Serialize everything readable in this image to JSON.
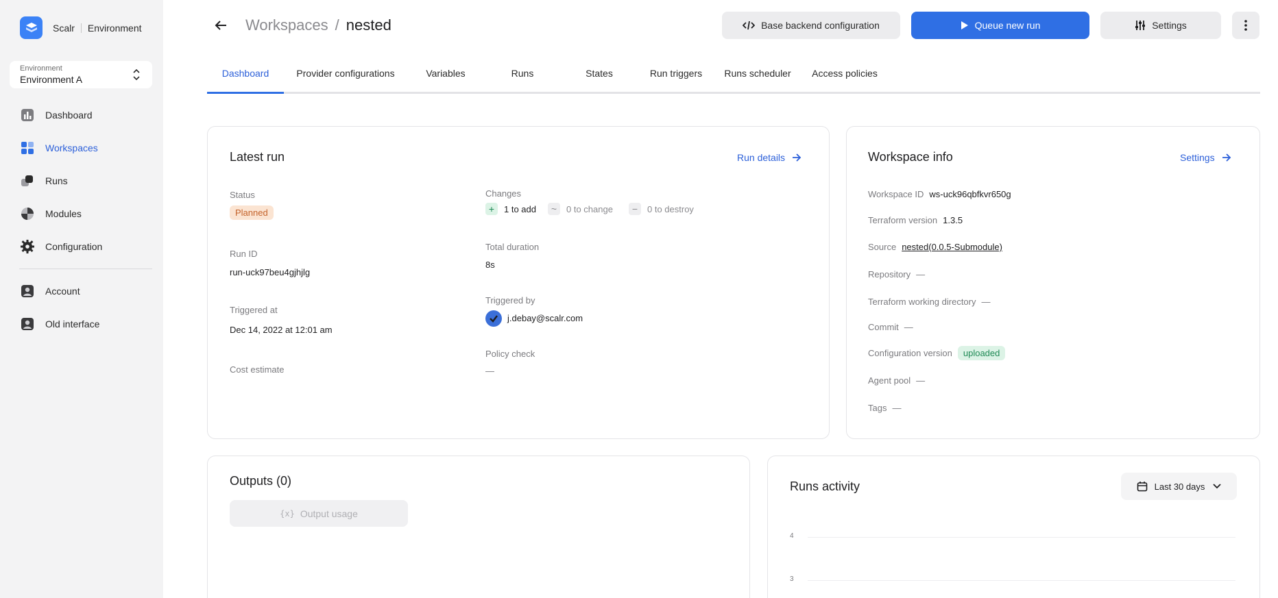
{
  "brand": {
    "name": "Scalr",
    "section": "Environment"
  },
  "environment": {
    "label": "Environment",
    "value": "Environment A"
  },
  "sidebar": {
    "items": [
      {
        "label": "Dashboard",
        "icon": "dashboard-icon"
      },
      {
        "label": "Workspaces",
        "icon": "workspaces-icon",
        "active": true
      },
      {
        "label": "Runs",
        "icon": "runs-icon"
      },
      {
        "label": "Modules",
        "icon": "modules-icon"
      },
      {
        "label": "Configuration",
        "icon": "gear-icon"
      },
      {
        "label": "Account",
        "icon": "account-icon"
      },
      {
        "label": "Old interface",
        "icon": "old-interface-icon"
      }
    ]
  },
  "header": {
    "parent": "Workspaces",
    "separator": "/",
    "current": "nested",
    "buttons": {
      "backend": "Base backend configuration",
      "queue": "Queue new run",
      "settings": "Settings"
    }
  },
  "tabs": [
    "Dashboard",
    "Provider configurations",
    "Variables",
    "Runs",
    "States",
    "Run triggers",
    "Runs scheduler",
    "Access policies"
  ],
  "latest_run": {
    "title": "Latest run",
    "details_link": "Run details",
    "status_label": "Status",
    "status": "Planned",
    "run_id_label": "Run ID",
    "run_id": "run-uck97beu4gjhjlg",
    "triggered_at_label": "Triggered at",
    "triggered_at": "Dec 14, 2022 at 12:01 am",
    "cost_label": "Cost estimate",
    "changes_label": "Changes",
    "changes": {
      "add": "1 to add",
      "change": "0 to change",
      "destroy": "0 to destroy"
    },
    "duration_label": "Total duration",
    "duration": "8s",
    "triggered_by_label": "Triggered by",
    "triggered_by": "j.debay@scalr.com",
    "policy_label": "Policy check",
    "policy": "—"
  },
  "workspace_info": {
    "title": "Workspace info",
    "settings_link": "Settings",
    "workspace_id_label": "Workspace ID",
    "workspace_id": "ws-uck96qbfkvr650g",
    "terraform_version_label": "Terraform version",
    "terraform_version": "1.3.5",
    "source_label": "Source",
    "source": "nested(0.0.5-Submodule)",
    "repository_label": "Repository",
    "repository": "—",
    "working_dir_label": "Terraform working directory",
    "working_dir": "—",
    "commit_label": "Commit",
    "commit": "—",
    "config_version_label": "Configuration version",
    "config_version": "uploaded",
    "agent_pool_label": "Agent pool",
    "agent_pool": "—",
    "tags_label": "Tags",
    "tags": "—"
  },
  "outputs": {
    "title": "Outputs (0)",
    "usage_button": "Output usage",
    "usage_icon": "{x}"
  },
  "runs_activity": {
    "title": "Runs activity",
    "range": "Last 30 days",
    "ticks": [
      "4",
      "3"
    ]
  },
  "colors": {
    "accent": "#2f6fe4",
    "planned": "#c4622a",
    "uploaded": "#1f8a55"
  }
}
